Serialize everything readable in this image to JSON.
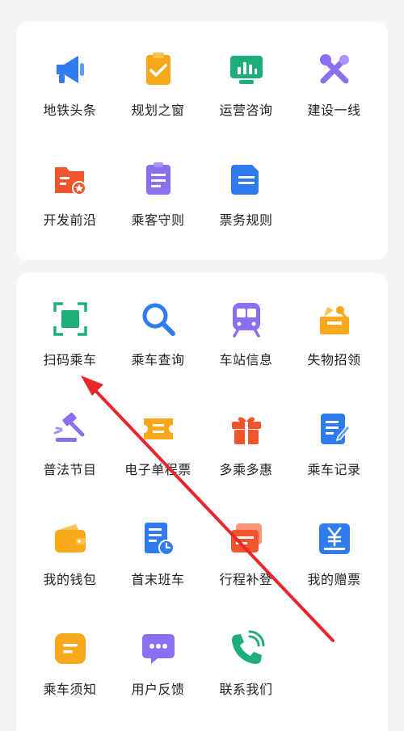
{
  "section1": {
    "items": [
      {
        "label": "地铁头条",
        "icon": "megaphone-icon"
      },
      {
        "label": "规划之窗",
        "icon": "clipboard-check-icon"
      },
      {
        "label": "运营咨询",
        "icon": "monitor-chart-icon"
      },
      {
        "label": "建设一线",
        "icon": "tools-icon"
      },
      {
        "label": "开发前沿",
        "icon": "folder-star-icon"
      },
      {
        "label": "乘客守则",
        "icon": "rules-document-icon"
      },
      {
        "label": "票务规则",
        "icon": "ticket-document-icon"
      }
    ]
  },
  "section2": {
    "items": [
      {
        "label": "扫码乘车",
        "icon": "qr-scan-icon"
      },
      {
        "label": "乘车查询",
        "icon": "search-icon"
      },
      {
        "label": "车站信息",
        "icon": "train-icon"
      },
      {
        "label": "失物招领",
        "icon": "lost-found-box-icon"
      },
      {
        "label": "普法节目",
        "icon": "gavel-icon"
      },
      {
        "label": "电子单程票",
        "icon": "e-ticket-icon"
      },
      {
        "label": "多乘多惠",
        "icon": "gift-icon"
      },
      {
        "label": "乘车记录",
        "icon": "record-edit-icon"
      },
      {
        "label": "我的钱包",
        "icon": "wallet-icon"
      },
      {
        "label": "首末班车",
        "icon": "schedule-clock-icon"
      },
      {
        "label": "行程补登",
        "icon": "trip-card-icon"
      },
      {
        "label": "我的赠票",
        "icon": "yuan-ticket-icon"
      },
      {
        "label": "乘车须知",
        "icon": "notice-icon"
      },
      {
        "label": "用户反馈",
        "icon": "chat-bubble-icon"
      },
      {
        "label": "联系我们",
        "icon": "phone-icon"
      }
    ]
  },
  "colors": {
    "blue": "#2f7bf0",
    "orange": "#f7a81b",
    "green": "#1fae7a",
    "purple": "#8a6ff0",
    "red_orange": "#f2552c",
    "annotation_red": "#e8262b"
  }
}
